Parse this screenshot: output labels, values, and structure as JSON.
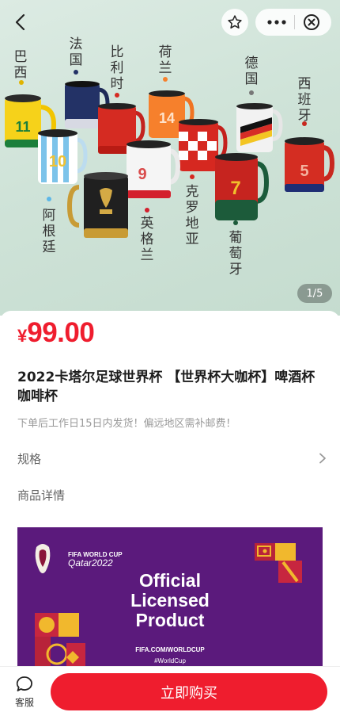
{
  "hero": {
    "image_counter": "1/5",
    "country_labels": {
      "brazil": "巴西",
      "france": "法国",
      "chile": "比利时",
      "netherlands": "荷兰",
      "germany": "德国",
      "spain": "西班牙",
      "argentina": "阿根廷",
      "england": "英格兰",
      "croatia": "克罗地亚",
      "portugal": "葡萄牙"
    },
    "mug_numbers": {
      "brazil": "11",
      "argentina": "10",
      "netherlands": "14",
      "england": "9",
      "portugal": "7",
      "spain": "5"
    }
  },
  "toolbar": {
    "back_icon": "chevron-left-icon",
    "favorite_icon": "star-outline-icon",
    "more_icon": "ellipsis-icon",
    "close_icon": "close-circle-icon"
  },
  "product": {
    "currency": "¥",
    "price": "99.00",
    "title": "2022卡塔尔足球世界杯 【世界杯大咖杯】啤酒杯咖啡杯",
    "shipping_note": "下单后工作日15日内发货！偏远地区需补邮费！",
    "spec_label": "规格",
    "detail_label": "商品详情"
  },
  "banner": {
    "brand_line1": "FIFA WORLD CUP",
    "brand_line2": "Qatar2022",
    "headline_line1": "Official",
    "headline_line2": "Licensed",
    "headline_line3": "Product",
    "url": "FIFA.COM/WORLDCUP",
    "hashtag": "#WorldCup"
  },
  "bottom_bar": {
    "customer_service_label": "客服",
    "buy_label": "立即购买"
  },
  "colors": {
    "accent_red": "#ef1d2e",
    "banner_purple": "#5b1a7c",
    "hero_bg": "#cfe3d8"
  }
}
